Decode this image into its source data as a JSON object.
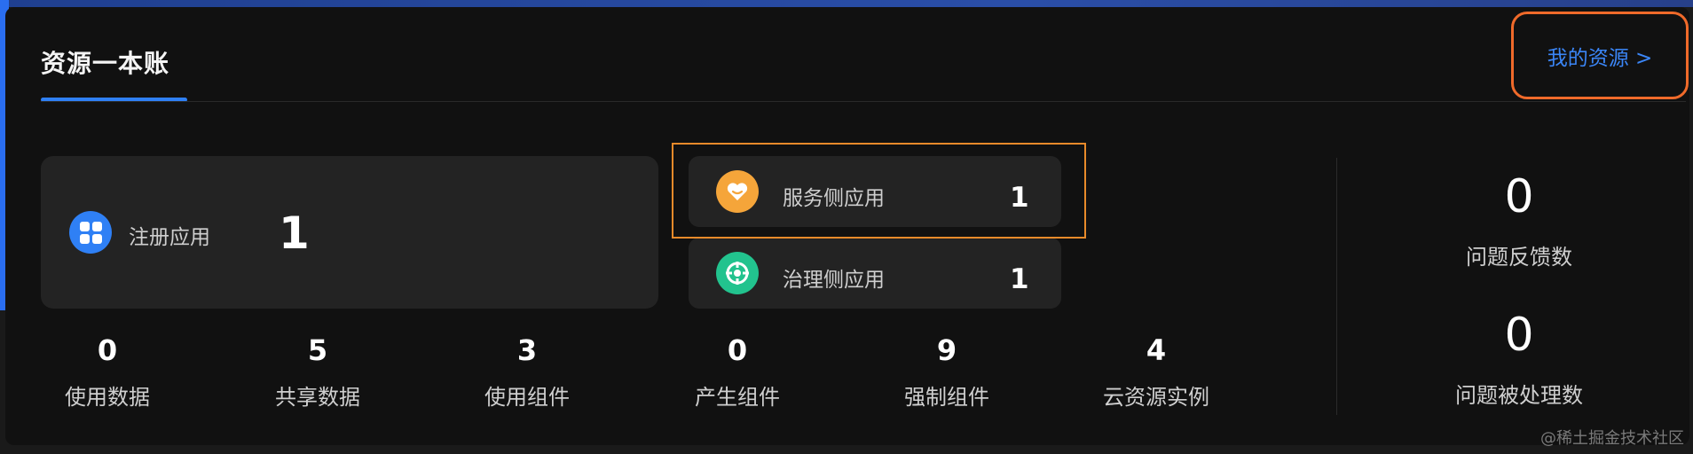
{
  "header": {
    "title": "资源一本账",
    "my_resources_link": "我的资源 >"
  },
  "registered_apps": {
    "label": "注册应用",
    "value": "1",
    "icon": "grid-icon"
  },
  "service_apps": {
    "label": "服务侧应用",
    "value": "1",
    "icon": "heart-icon",
    "icon_color": "#f5a53a"
  },
  "governance_apps": {
    "label": "治理侧应用",
    "value": "1",
    "icon": "target-icon",
    "icon_color": "#22c38e"
  },
  "stats": [
    {
      "value": "0",
      "label": "使用数据"
    },
    {
      "value": "5",
      "label": "共享数据"
    },
    {
      "value": "3",
      "label": "使用组件"
    },
    {
      "value": "0",
      "label": "产生组件"
    },
    {
      "value": "9",
      "label": "强制组件"
    },
    {
      "value": "4",
      "label": "云资源实例"
    }
  ],
  "side_stats": [
    {
      "value": "0",
      "label": "问题反馈数"
    },
    {
      "value": "0",
      "label": "问题被处理数"
    }
  ],
  "watermark": "@稀土掘金技术社区",
  "colors": {
    "accent": "#2f80f5",
    "highlight_orange": "#e88a2a",
    "link_box_orange": "#f06a2a",
    "background": "#111111",
    "panel": "#232323"
  }
}
